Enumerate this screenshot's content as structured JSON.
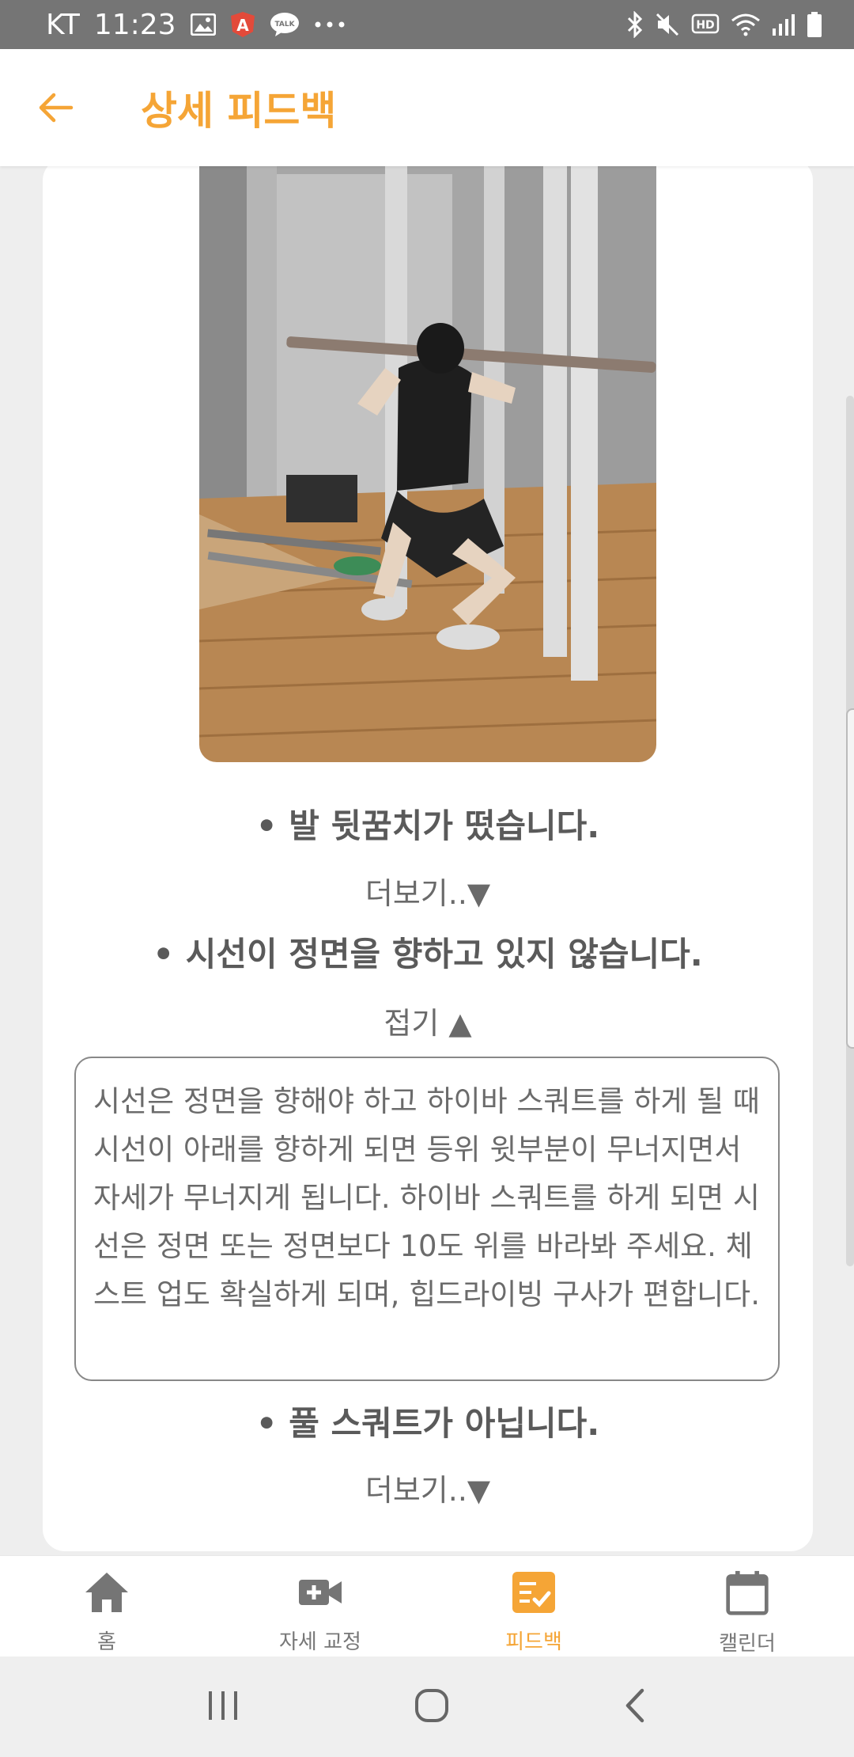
{
  "status_bar": {
    "carrier": "KT",
    "time": "11:23",
    "left_icons": [
      "image-icon",
      "app-a-icon",
      "talk-icon",
      "more-dots-icon"
    ],
    "right_icons": [
      "bluetooth-icon",
      "mute-icon",
      "hd-icon",
      "wifi-icon",
      "signal-icon",
      "battery-icon"
    ],
    "hd_label": "HD",
    "talk_label": "TALK"
  },
  "app_bar": {
    "title": "상세 피드백",
    "accent_color": "#f5a536"
  },
  "feedback": [
    {
      "title": "• 발 뒷꿈치가 떴습니다.",
      "toggle": "더보기..▼",
      "expanded": false
    },
    {
      "title": "• 시선이 정면을 향하고 있지 않습니다.",
      "toggle": "접기 ▲",
      "expanded": true,
      "detail": "시선은 정면을 향해야 하고 하이바 스쿼트를 하게 될 때 시선이 아래를 향하게 되면 등위 윗부분이 무너지면서 자세가 무너지게 됩니다. 하이바 스쿼트를 하게 되면 시선은 정면 또는 정면보다 10도 위를 바라봐 주세요. 체스트 업도 확실하게 되며, 힙드라이빙 구사가 편합니다."
    },
    {
      "title": "• 풀 스쿼트가 아닙니다.",
      "toggle": "더보기..▼",
      "expanded": false
    }
  ],
  "bottom_nav": {
    "items": [
      {
        "label": "홈",
        "icon": "home-icon",
        "active": false
      },
      {
        "label": "자세 교정",
        "icon": "video-add-icon",
        "active": false
      },
      {
        "label": "피드백",
        "icon": "checklist-icon",
        "active": true
      },
      {
        "label": "캘린더",
        "icon": "calendar-icon",
        "active": false
      }
    ]
  },
  "system_nav": [
    "recents-button",
    "home-button",
    "back-button"
  ]
}
